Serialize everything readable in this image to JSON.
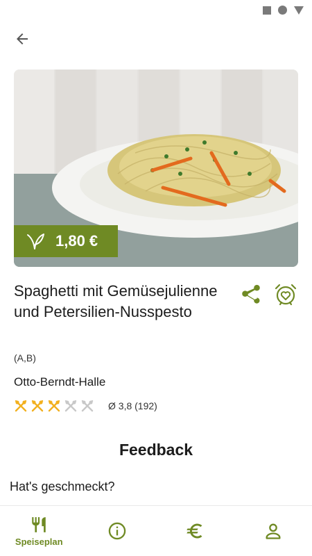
{
  "colors": {
    "accent": "#6f8a24",
    "star_filled": "#f2b01e",
    "star_empty": "#c8c8c8"
  },
  "status_bar": {
    "icons": [
      "square-icon",
      "circle-icon",
      "triangle-icon"
    ]
  },
  "dish": {
    "price": "1,80 €",
    "title": "Spaghetti mit Gemüsejulienne und Petersilien-Nusspesto",
    "allergens": "(A,B)",
    "location": "Otto-Berndt-Halle",
    "rating_text": "Ø 3,8 (192)",
    "rating_value": 3.8,
    "rating_max": 5,
    "icon": "vegan-leaf-icon"
  },
  "feedback": {
    "title": "Feedback",
    "question": "Hat's geschmeckt?"
  },
  "nav": [
    {
      "label": "Speiseplan",
      "icon": "fork-knife-icon",
      "active": true
    },
    {
      "label": "",
      "icon": "info-icon",
      "active": false
    },
    {
      "label": "",
      "icon": "euro-icon",
      "active": false
    },
    {
      "label": "",
      "icon": "person-icon",
      "active": false
    }
  ]
}
